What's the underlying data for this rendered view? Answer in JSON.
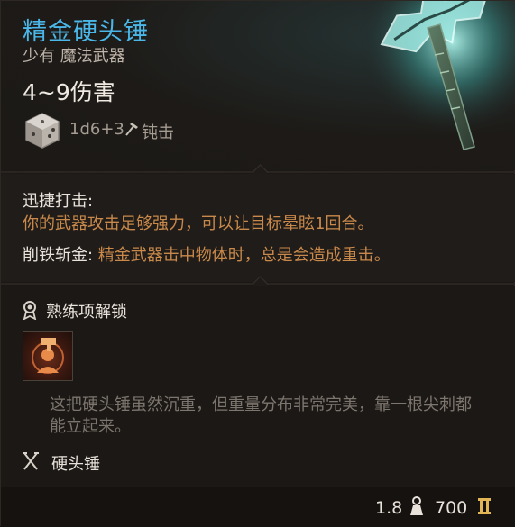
{
  "item": {
    "name": "精金硬头锤",
    "rarity_type": "少有 魔法武器",
    "damage": "4~9伤害",
    "dice_formula": "1d6+3",
    "damage_type": "钝击",
    "icons": [
      "dice-icon",
      "hammer-small-icon",
      "weapon-art-icon"
    ]
  },
  "abilities": {
    "first_title": "迅捷打击:",
    "first_desc": "你的武器攻击足够强力，可以让目标晕眩1回合。",
    "second_title": "削铁斩金:",
    "second_desc": " 精金武器击中物体时，总是会造成重击。"
  },
  "proficiency": {
    "title": "熟练项解锁",
    "icons": [
      "medal-icon",
      "skill-icon"
    ]
  },
  "flavor": "这把硬头锤虽然沉重，但重量分布非常完美，靠一根尖刺都能立起来。",
  "weapon_type": {
    "label": "硬头锤",
    "icon": "crossed-weapons-icon"
  },
  "footer": {
    "weight": "1.8",
    "price": "700",
    "icons": [
      "weight-icon",
      "gold-icon"
    ]
  },
  "colors": {
    "title": "#4ab7e8",
    "accent_orange": "#c9894a",
    "text": "#e8e2da",
    "muted": "#7d766e"
  }
}
